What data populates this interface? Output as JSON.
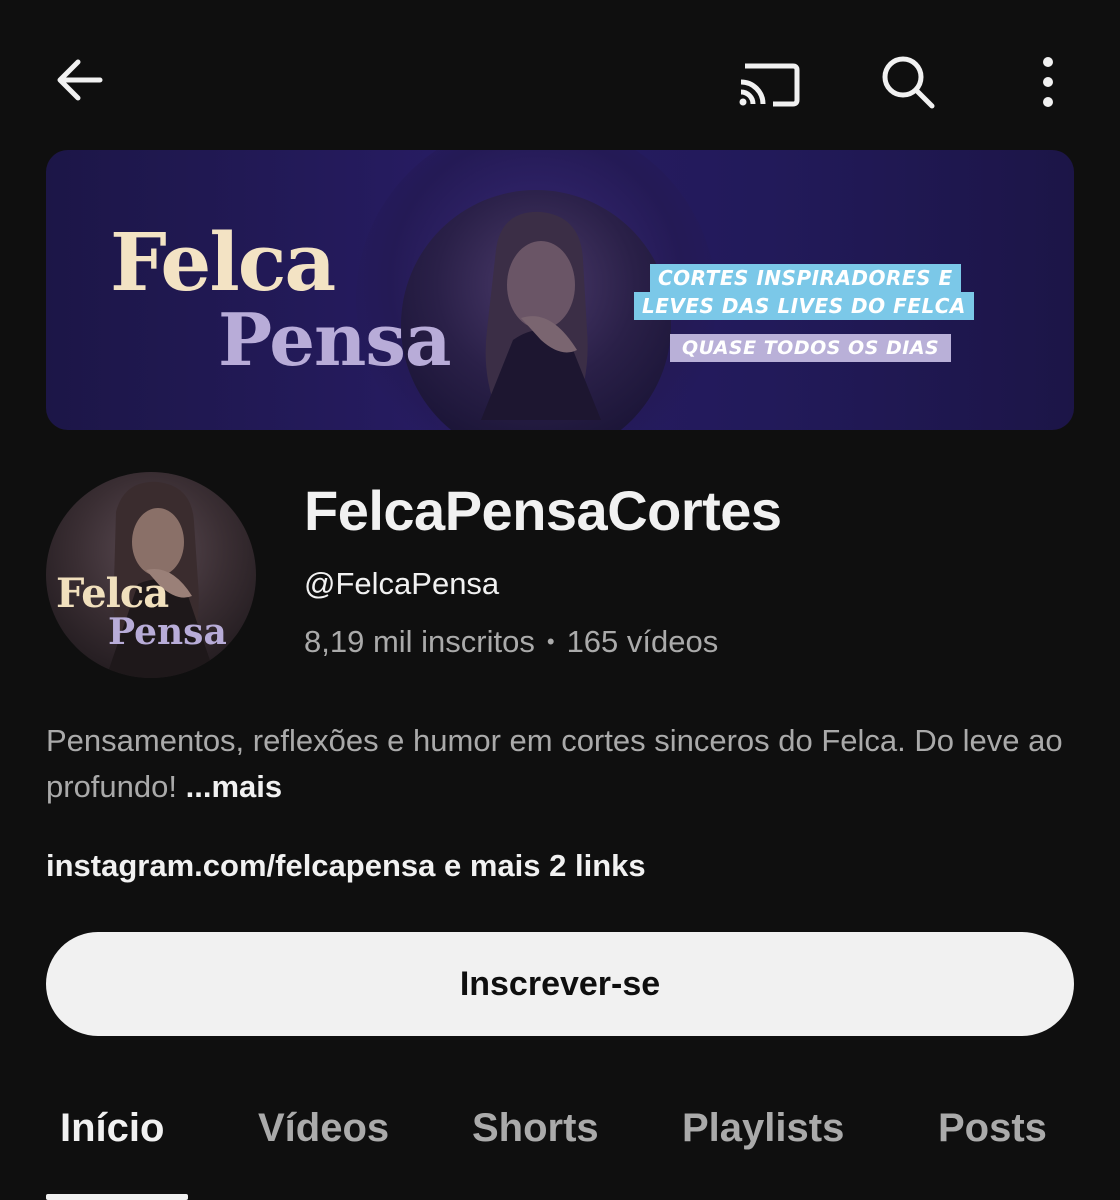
{
  "topbar": {
    "back_icon": "arrow-left-icon",
    "cast_icon": "cast-icon",
    "search_icon": "search-icon",
    "more_icon": "more-vertical-icon"
  },
  "banner": {
    "title_line1": "Felca",
    "title_line2": "Pensa",
    "tag_line1": "CORTES INSPIRADORES E",
    "tag_line2": "LEVES DAS LIVES DO FELCA",
    "tag_line3": "QUASE TODOS OS DIAS",
    "colors": {
      "background": "#231a5c",
      "title_line1": "#f3e3c4",
      "title_line2": "#b8acd8",
      "tag_blue": "#7bc8e8",
      "tag_lilac": "#b9b0d8"
    }
  },
  "avatar": {
    "text_line1": "Felca",
    "text_line2": "Pensa"
  },
  "channel": {
    "name": "FelcaPensaCortes",
    "handle": "@FelcaPensa",
    "subscribers": "8,19 mil inscritos",
    "separator": "•",
    "videos": "165 vídeos",
    "description": "Pensamentos, reflexões e humor em cortes sinceros do Felca. Do leve ao profundo!",
    "more_label": "...mais",
    "links": "instagram.com/felcapensa e mais 2 links"
  },
  "subscribe": {
    "label": "Inscrever-se"
  },
  "tabs": [
    {
      "label": "Início",
      "active": true
    },
    {
      "label": "Vídeos",
      "active": false
    },
    {
      "label": "Shorts",
      "active": false
    },
    {
      "label": "Playlists",
      "active": false
    },
    {
      "label": "Posts",
      "active": false
    }
  ],
  "colors": {
    "background": "#0f0f0f",
    "text_primary": "#f1f1f1",
    "text_secondary": "#aaaaaa",
    "button_bg": "#f1f1f1"
  }
}
